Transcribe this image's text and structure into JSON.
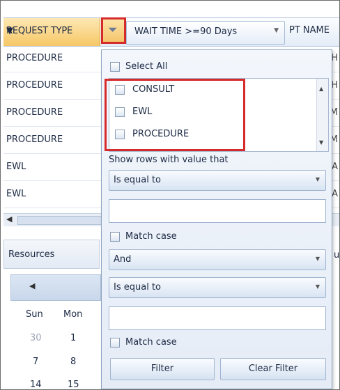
{
  "grid": {
    "columns": {
      "request_type": "REQUEST TYPE",
      "wait_time": "WAIT TIME >=90 Days",
      "pt_name": "PT NAME"
    },
    "rows": [
      {
        "request_type": "PROCEDURE",
        "tail": "H"
      },
      {
        "request_type": "PROCEDURE",
        "tail": "H"
      },
      {
        "request_type": "PROCEDURE",
        "tail": "M"
      },
      {
        "request_type": "PROCEDURE",
        "tail": "M"
      },
      {
        "request_type": "EWL",
        "tail": "A"
      },
      {
        "request_type": "EWL",
        "tail": "A"
      }
    ]
  },
  "resources": {
    "title": "Resources",
    "right_fragment": "ul",
    "weekdays": [
      "Sun",
      "Mon"
    ],
    "weeks": [
      [
        "30",
        "1"
      ],
      [
        "7",
        "8"
      ],
      [
        "14",
        "15"
      ]
    ]
  },
  "filter_popup": {
    "select_all": "Select All",
    "options": [
      "CONSULT",
      "EWL",
      "PROCEDURE"
    ],
    "show_rows_label": "Show rows with value that",
    "operator1": "Is equal to",
    "match_case": "Match case",
    "logic_operator": "And",
    "operator2": "Is equal to",
    "filter_button": "Filter",
    "clear_filter_button": "Clear Filter"
  },
  "colors": {
    "highlight": "#d62b2b",
    "header_active": "#f6c766"
  }
}
